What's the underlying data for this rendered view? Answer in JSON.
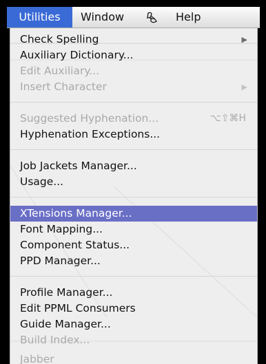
{
  "menubar": {
    "utilities": "Utilities",
    "window": "Window",
    "script_icon": "script-icon",
    "help": "Help"
  },
  "menu": {
    "check_spelling": "Check Spelling",
    "auxiliary_dictionary": "Auxiliary Dictionary...",
    "edit_auxiliary": "Edit Auxiliary...",
    "insert_character": "Insert Character",
    "suggested_hyphenation": "Suggested Hyphenation...",
    "suggested_hyphenation_shortcut": "⌥⇧⌘H",
    "hyphenation_exceptions": "Hyphenation Exceptions...",
    "job_jackets_manager": "Job Jackets Manager...",
    "usage": "Usage...",
    "xtensions_manager": "XTensions Manager...",
    "font_mapping": "Font Mapping...",
    "component_status": "Component Status...",
    "ppd_manager": "PPD Manager...",
    "profile_manager": "Profile Manager...",
    "edit_ppml_consumers": "Edit PPML Consumers",
    "guide_manager": "Guide Manager...",
    "build_index": "Build Index...",
    "jabber": "Jabber",
    "submenu_arrow": "▶"
  },
  "colors": {
    "menubar_highlight": "#3a6ad6",
    "item_highlight": "#6a6fc6",
    "disabled_text": "#a9a9a9"
  }
}
